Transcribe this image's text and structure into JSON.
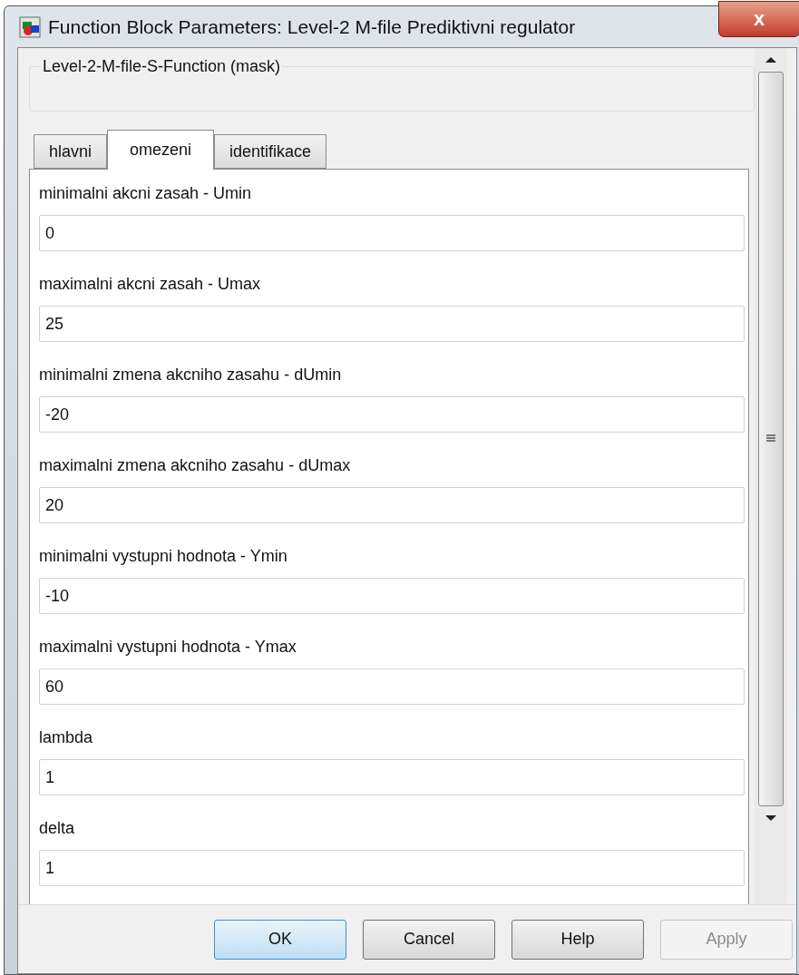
{
  "window": {
    "title": "Function Block Parameters: Level-2 M-file Prediktivni regulator",
    "close": "x"
  },
  "group": {
    "title": "Level-2-M-file-S-Function (mask)"
  },
  "tabs": [
    {
      "label": "hlavni",
      "selected": false
    },
    {
      "label": "omezeni",
      "selected": true
    },
    {
      "label": "identifikace",
      "selected": false
    }
  ],
  "params": [
    {
      "label": "minimalni akcni zasah - Umin",
      "value": "0"
    },
    {
      "label": "maximalni akcni zasah - Umax",
      "value": "25"
    },
    {
      "label": "minimalni zmena akcniho zasahu - dUmin",
      "value": "-20"
    },
    {
      "label": "maximalni zmena akcniho zasahu - dUmax",
      "value": "20"
    },
    {
      "label": "minimalni vystupni hodnota - Ymin",
      "value": "-10"
    },
    {
      "label": "maximalni vystupni hodnota - Ymax",
      "value": "60"
    },
    {
      "label": "lambda",
      "value": "1"
    },
    {
      "label": "delta",
      "value": "1"
    }
  ],
  "buttons": [
    {
      "label": "OK",
      "default": true,
      "disabled": false
    },
    {
      "label": "Cancel",
      "default": false,
      "disabled": false
    },
    {
      "label": "Help",
      "default": false,
      "disabled": false
    },
    {
      "label": "Apply",
      "default": false,
      "disabled": true
    }
  ]
}
